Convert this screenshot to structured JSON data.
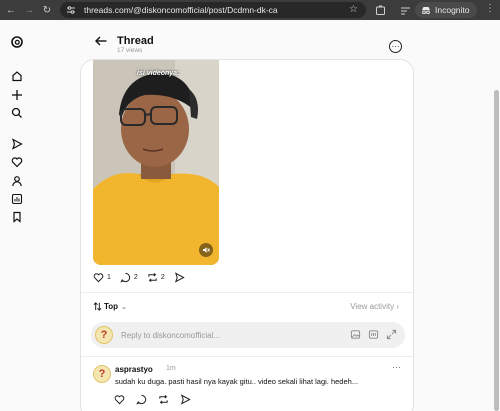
{
  "browser": {
    "url": "threads.com/@diskoncomofficial/post/Dcdmn-dk-ca",
    "incognito_label": "Incognito"
  },
  "header": {
    "title": "Thread",
    "views": "17 views"
  },
  "post": {
    "video_caption": "isi videonya:",
    "likes": "1",
    "comments": "2",
    "reposts": "2"
  },
  "replies_bar": {
    "sort_label": "Top",
    "view_activity_label": "View activity",
    "reply_placeholder": "Reply to diskoncomofficial..."
  },
  "comment": {
    "username": "asprastyo",
    "time": "1m",
    "text": "sudah ku duga. pasti hasil nya kayak gitu.. video sekali lihat lagi. hedeh..."
  },
  "colors": {
    "chrome_bg": "#3c3c3c",
    "page_bg": "#fafafa",
    "card_bg": "#ffffff",
    "muted_text": "#999999"
  }
}
